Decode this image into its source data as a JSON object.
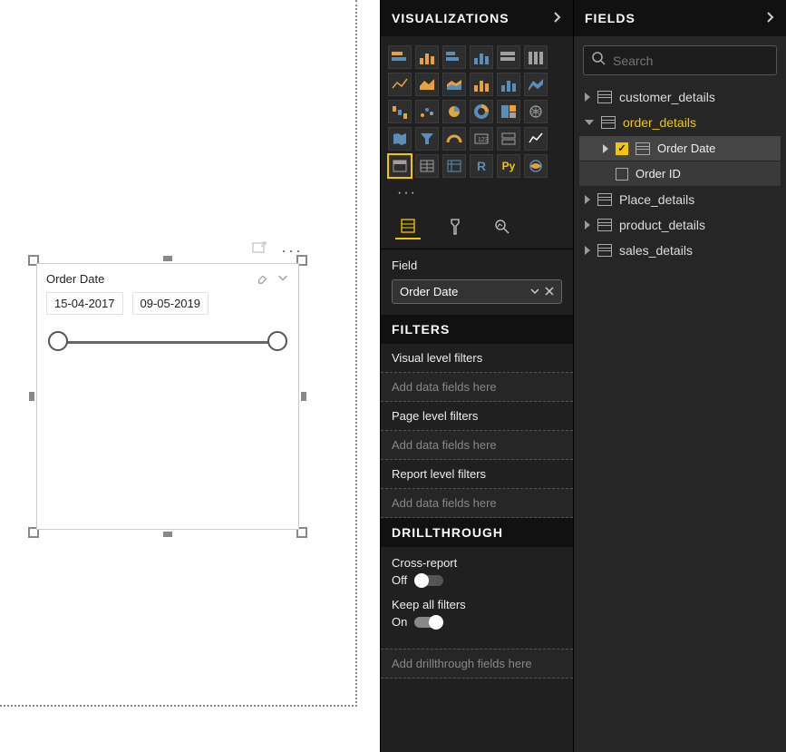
{
  "canvas": {
    "slicer_title": "Order Date",
    "date_from": "15-04-2017",
    "date_to": "09-05-2019"
  },
  "viz_pane": {
    "title": "VISUALIZATIONS",
    "more": "···",
    "field_label": "Field",
    "field_chip": "Order Date",
    "filters_title": "FILTERS",
    "filters": {
      "visual": "Visual level filters",
      "page": "Page level filters",
      "report": "Report level filters",
      "placeholder": "Add data fields here"
    },
    "drill_title": "DRILLTHROUGH",
    "drill": {
      "cross_report_label": "Cross-report",
      "cross_report_value": "Off",
      "keep_filters_label": "Keep all filters",
      "keep_filters_value": "On",
      "placeholder": "Add drillthrough fields here"
    }
  },
  "fields_pane": {
    "title": "FIELDS",
    "search_placeholder": "Search",
    "tables": {
      "customer_details": "customer_details",
      "order_details": "order_details",
      "place_details": "Place_details",
      "product_details": "product_details",
      "sales_details": "sales_details"
    },
    "order_details_fields": {
      "order_date": "Order Date",
      "order_id": "Order ID"
    }
  }
}
